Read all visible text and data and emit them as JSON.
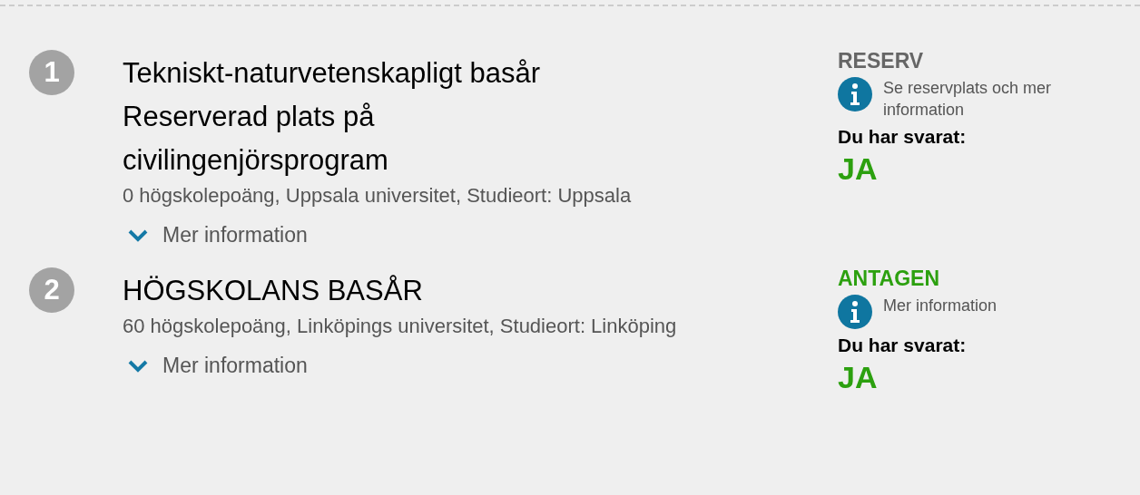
{
  "choices": [
    {
      "number": "1",
      "title_lines": [
        "Tekniskt-naturvetenskapligt basår",
        "Reserverad plats på",
        "civilingenjörsprogram"
      ],
      "details": "0 högskolepoäng, Uppsala universitet, Studieort: Uppsala",
      "more_link": "Mer information",
      "status": "RESERV",
      "color": "#666666",
      "info_text": "Se reservplats och mer information",
      "answer_label": "Du har svarat:",
      "answer": "JA"
    },
    {
      "number": "2",
      "title_lines": [
        "HÖGSKOLANS BASÅR"
      ],
      "details": "60 högskolepoäng, Linköpings universitet, Studieort: Linköping",
      "more_link": "Mer information",
      "status": "ANTAGEN",
      "color": "#2ca00f",
      "info_text": "Mer information",
      "answer_label": "Du har svarat:",
      "answer": "JA"
    }
  ]
}
